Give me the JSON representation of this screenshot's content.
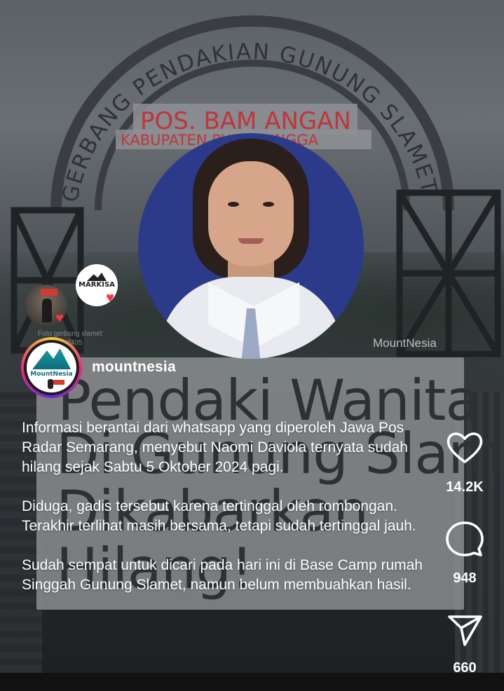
{
  "background": {
    "gate_text_arch": "GERBANG PENDAKIAN GUNUNG SLAMET",
    "gate_sign_1": "POS. BAM ANGAN",
    "gate_sign_2": "KABUPATEN PURBALINGGA"
  },
  "headline": {
    "line1": "Pendaki Wanita",
    "line2": "Di Gunung Slamet",
    "line3": "Dikabarkan",
    "line4": "Hilang!"
  },
  "watermark": "MountNesia",
  "stickers": {
    "caption_line1": "Foto gerbang slamet",
    "caption_line2": "foto by mtf405",
    "markisa_label": "MARKISA"
  },
  "author": {
    "username": "mountnesia",
    "avatar_label": "MountNesia"
  },
  "caption": {
    "p1": "Informasi berantai dari whatsapp yang diperoleh Jawa Pos Radar Semarang, menyebut Naomi Daviola ternyata sudah hilang sejak Sabtu 5 Oktober 2024 pagi.",
    "p2": "Diduga, gadis tersebut karena tertinggal oleh rombongan. Terakhir terlihat masih bersama, tetapi sudah tertinggal jauh.",
    "p3": "Sudah sempat untuk dicari pada hari ini di Base Camp rumah Singgah Gunung Slamet, namun belum membuahkan hasil."
  },
  "actions": {
    "likes": "14.2K",
    "comments": "948",
    "shares": "660"
  },
  "colors": {
    "like_heart": "#ff3040",
    "portrait_bg": "#2c3a8a",
    "sign_red": "#c0353a"
  }
}
